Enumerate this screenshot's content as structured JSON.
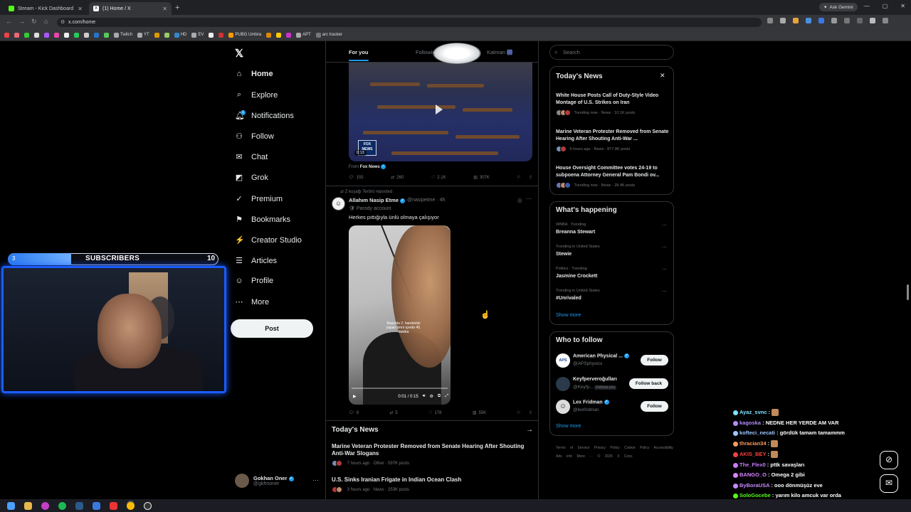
{
  "browser": {
    "tabs": [
      {
        "label": "Stream - Kick Dashboard",
        "favicon_color": "#53fc18"
      },
      {
        "label": "(1) Home / X",
        "favicon_color": "#ffffff"
      }
    ],
    "new_tab": "+",
    "gemini": "Ask Gemini",
    "url": "x.com/home",
    "bookmarks": [
      "Twitch",
      "YT",
      "HD",
      "EV",
      "PUBG Umbra",
      "APT",
      "arc tracker"
    ]
  },
  "x": {
    "logo": "𝕏",
    "nav": [
      {
        "label": "Home",
        "icon": "⌂",
        "icon_name": "home-icon"
      },
      {
        "label": "Explore",
        "icon": "⌕",
        "icon_name": "search-icon"
      },
      {
        "label": "Notifications",
        "icon": "🔔︎",
        "icon_name": "bell-icon"
      },
      {
        "label": "Follow",
        "icon": "⚇",
        "icon_name": "person-plus-icon"
      },
      {
        "label": "Chat",
        "icon": "✉",
        "icon_name": "mail-icon"
      },
      {
        "label": "Grok",
        "icon": "◩",
        "icon_name": "grok-icon"
      },
      {
        "label": "Premium",
        "icon": "✓",
        "icon_name": "premium-icon"
      },
      {
        "label": "Bookmarks",
        "icon": "⚑",
        "icon_name": "bookmark-icon"
      },
      {
        "label": "Creator Studio",
        "icon": "⚡",
        "icon_name": "creator-icon"
      },
      {
        "label": "Articles",
        "icon": "☰",
        "icon_name": "articles-icon"
      },
      {
        "label": "Profile",
        "icon": "☺",
        "icon_name": "profile-icon"
      },
      {
        "label": "More",
        "icon": "⋯",
        "icon_name": "more-icon"
      }
    ],
    "notif_count": "1",
    "post_button": "Post",
    "account": {
      "name": "Gokhan Oner",
      "handle": "@gkhnoner"
    },
    "feed_tabs": [
      "For you",
      "Following",
      "Katman 🎆"
    ],
    "tweet1": {
      "video_time": "0:13",
      "fox_logo": "FOX NEWS",
      "from_label": "From",
      "from_source": "Fox News",
      "replies": "155",
      "reposts": "260",
      "likes": "2.1K",
      "views": "307K"
    },
    "tweet2": {
      "reposted_by": "Z kuşağı Terörü reposted",
      "author": "Allahım Nasip Etme",
      "handle": "@nasipetme · 4h",
      "parody": "Parody account",
      "text": "Herkes pıttığıyla ünlü olmaya çalışıyor",
      "video_caption": "Başında 2. hareketini yapan birini içerde 45. dakika",
      "video_time": "0:01 / 0:15",
      "replies": "9",
      "reposts": "5",
      "likes": "178",
      "views": "55K"
    },
    "feed_news": {
      "title": "Today's News",
      "items": [
        {
          "headline": "Marine Veteran Protester Removed from Senate Hearing After Shouting Anti-War Slogans",
          "meta": "7 hours ago · Other · 597K posts"
        },
        {
          "headline": "U.S. Sinks Iranian Frigate in Indian Ocean Clash",
          "meta": "3 hours ago · News · 253K posts"
        }
      ]
    },
    "search_placeholder": "Search",
    "right_news": {
      "title": "Today's News",
      "items": [
        {
          "headline": "White House Posts Call of Duty-Style Video Montage of U.S. Strikes on Iran",
          "meta": "Trending now · News · 10.1K posts"
        },
        {
          "headline": "Marine Veteran Protester Removed from Senate Hearing After Shouting Anti-War ...",
          "meta": "6 hours ago · News · 877.8K posts"
        },
        {
          "headline": "House Oversight Committee votes 24-19 to subpoena Attorney General Pam Bondi ov...",
          "meta": "Trending now · News · 28.4K posts"
        }
      ]
    },
    "happening": {
      "title": "What's happening",
      "items": [
        {
          "context": "WNBA · Trending",
          "topic": "Breanna Stewart"
        },
        {
          "context": "Trending in United States",
          "topic": "Stewie"
        },
        {
          "context": "Politics · Trending",
          "topic": "Jasmine Crockett"
        },
        {
          "context": "Trending in United States",
          "topic": "#Unrivaled"
        }
      ],
      "show_more": "Show more"
    },
    "who_to_follow": {
      "title": "Who to follow",
      "items": [
        {
          "name": "American Physical ...",
          "handle": "@APSphysics",
          "button": "Follow",
          "avatar_text": "APS"
        },
        {
          "name": "Keyfperveroğulları",
          "handle": "@Keyfp...",
          "follows_you": "Follows you",
          "button": "Follow back"
        },
        {
          "name": "Lex Fridman",
          "handle": "@lexfridman",
          "button": "Follow"
        }
      ],
      "show_more": "Show more"
    },
    "footer": "Terms of Service Privacy Policy Cookie Policy Accessibility Ads info More ··· © 2026 X Corp."
  },
  "stream": {
    "sub_current": "3",
    "sub_label": "SUBSCRIBERS",
    "sub_goal": "10",
    "sub_progress": 0.3
  },
  "chat": [
    {
      "user": "Ayaz_svnc",
      "color": "#7be3ff",
      "msg": ""
    },
    {
      "user": "kagoska",
      "color": "#b48cff",
      "msg": "NEDNE HER YERDE AM VAR"
    },
    {
      "user": "kofteci_necati",
      "color": "#9fc7ff",
      "msg": "gördük tamam tamammm"
    },
    {
      "user": "thracian34",
      "color": "#ff9b5e",
      "msg": ""
    },
    {
      "user": "AKIS_BEY",
      "color": "#ff4040",
      "msg": ""
    },
    {
      "user": "The_Flex0",
      "color": "#c77bff",
      "msg": "pttk savaşları"
    },
    {
      "user": "BANGO_O",
      "color": "#d884ff",
      "msg": "Omega 2 gibi"
    },
    {
      "user": "ByBoraUSA",
      "color": "#c68bff",
      "msg": "ooo dönmüşüz eve"
    },
    {
      "user": "SoloGocebe",
      "color": "#53fc18",
      "msg": "yarım kilo amcuk var orda"
    },
    {
      "user": "BotRix",
      "color": "#53fc18",
      "msg": "@ByBoraUSA, 6. sevi"
    }
  ]
}
